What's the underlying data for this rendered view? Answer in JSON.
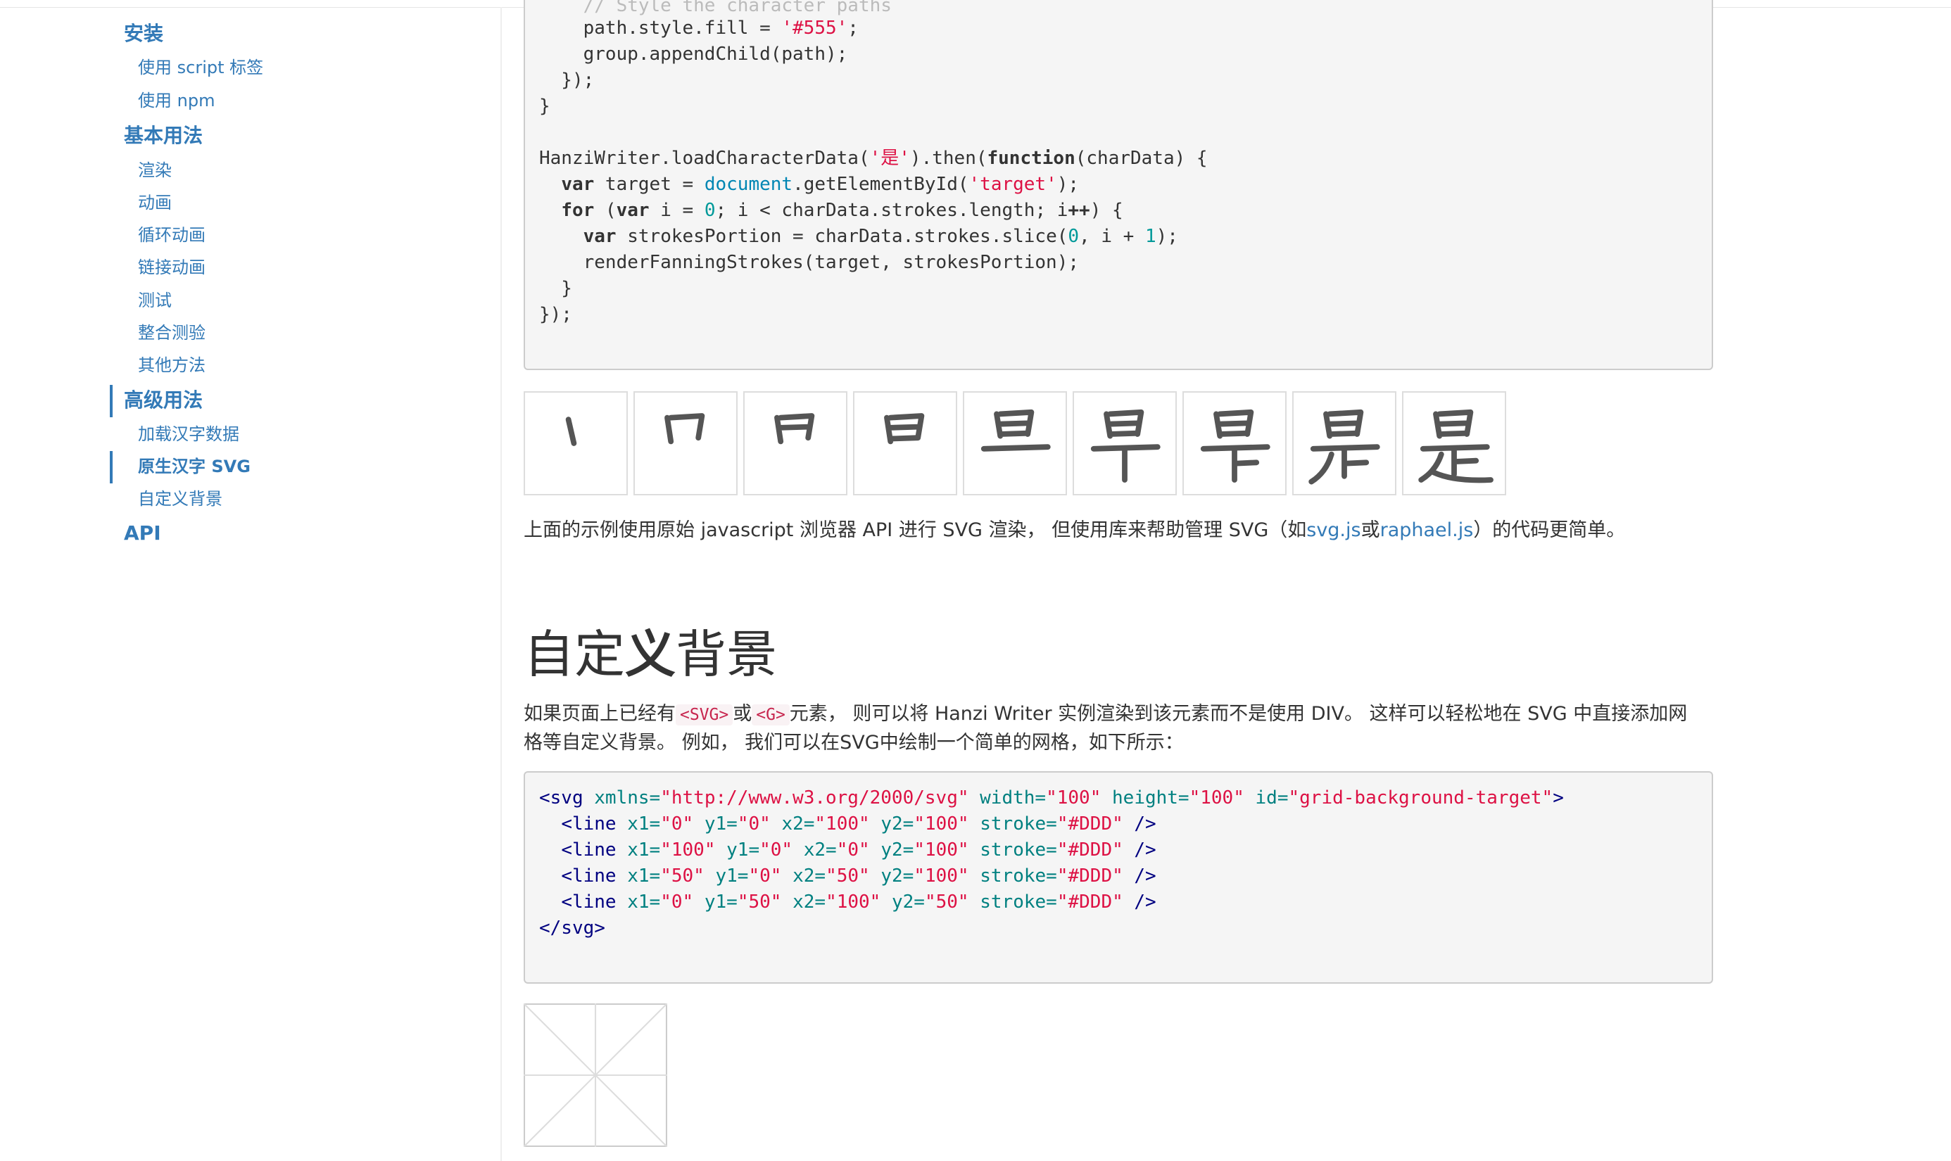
{
  "sidebar": {
    "items": [
      {
        "label": "安装",
        "level": 2
      },
      {
        "label": "使用 script 标签",
        "level": 3
      },
      {
        "label": "使用 npm",
        "level": 3
      },
      {
        "label": "基本用法",
        "level": 2
      },
      {
        "label": "渲染",
        "level": 3
      },
      {
        "label": "动画",
        "level": 3
      },
      {
        "label": "循环动画",
        "level": 3
      },
      {
        "label": "链接动画",
        "level": 3
      },
      {
        "label": "测试",
        "level": 3
      },
      {
        "label": "整合测验",
        "level": 3
      },
      {
        "label": "其他方法",
        "level": 3
      },
      {
        "label": "高级用法",
        "level": 2,
        "active_section": true
      },
      {
        "label": "加载汉字数据",
        "level": 3
      },
      {
        "label": "原生汉字 SVG",
        "level": 3,
        "active": true
      },
      {
        "label": "自定义背景",
        "level": 3
      },
      {
        "label": "API",
        "level": 2
      }
    ]
  },
  "code1": {
    "line0": "    path.style.fill = '#555';",
    "line1": "    group.appendChild(path);",
    "line2": "  });",
    "line3": "}",
    "line4": "HanziWriter.loadCharacterData('是').then(function(charData) {",
    "line5": "  var target = document.getElementById('target');",
    "line6": "  for (var i = 0; i < charData.strokes.length; i++) {",
    "line7": "    var strokesPortion = charData.strokes.slice(0, i + 1);",
    "line8": "    renderFanningStrokes(target, strokesPortion);",
    "line9": "  }",
    "line10": "});"
  },
  "stroke_demo": {
    "character": "是",
    "stroke_count": 9
  },
  "para1": {
    "before": "上面的示例使用原始 javascript 浏览器 API 进行 SVG 渲染， 但使用库来帮助管理 SVG（如",
    "link1": "svg.js",
    "middle": "或",
    "link2": "raphael.js",
    "after": "）的代码更简单。"
  },
  "section": {
    "title_part1": "自定",
    "title_bold": "义",
    "title_part2": "背景"
  },
  "para2": {
    "t1": "如果页面上已经有",
    "code1": "<SVG>",
    "t2": "或",
    "code2": "<G>",
    "t3": "元素， 则可以将 Hanzi Writer 实例渲染到该元素而不是使用 DIV。 这样可以轻松地在 SVG 中直接添加网",
    "t4": "格等自定义背景。 例如， 我们可以在SVG中绘制一个简单的网格，如下所示："
  },
  "code2": {
    "svg_open": "<svg",
    "xmlns_attr": "xmlns=",
    "xmlns_val": "\"http://www.w3.org/2000/svg\"",
    "width_attr": "width=",
    "width_val": "\"100\"",
    "height_attr": "height=",
    "height_val": "\"100\"",
    "id_attr": "id=",
    "id_val": "\"grid-background-target\"",
    "close": ">",
    "lines": [
      {
        "x1": "\"0\"",
        "y1": "\"0\"",
        "x2": "\"100\"",
        "y2": "\"100\"",
        "stroke": "\"#DDD\""
      },
      {
        "x1": "\"100\"",
        "y1": "\"0\"",
        "x2": "\"0\"",
        "y2": "\"100\"",
        "stroke": "\"#DDD\""
      },
      {
        "x1": "\"50\"",
        "y1": "\"0\"",
        "x2": "\"50\"",
        "y2": "\"100\"",
        "stroke": "\"#DDD\""
      },
      {
        "x1": "\"0\"",
        "y1": "\"50\"",
        "x2": "\"100\"",
        "y2": "\"50\"",
        "stroke": "\"#DDD\""
      }
    ],
    "line_tag": "<line",
    "self_close": "/>",
    "svg_close": "</svg>"
  },
  "colors": {
    "link": "#337ab7",
    "string": "#dd1144",
    "number": "#009999",
    "tag": "#000080",
    "attr": "#008080",
    "stroke": "#555555",
    "grid": "#DDDDDD"
  }
}
